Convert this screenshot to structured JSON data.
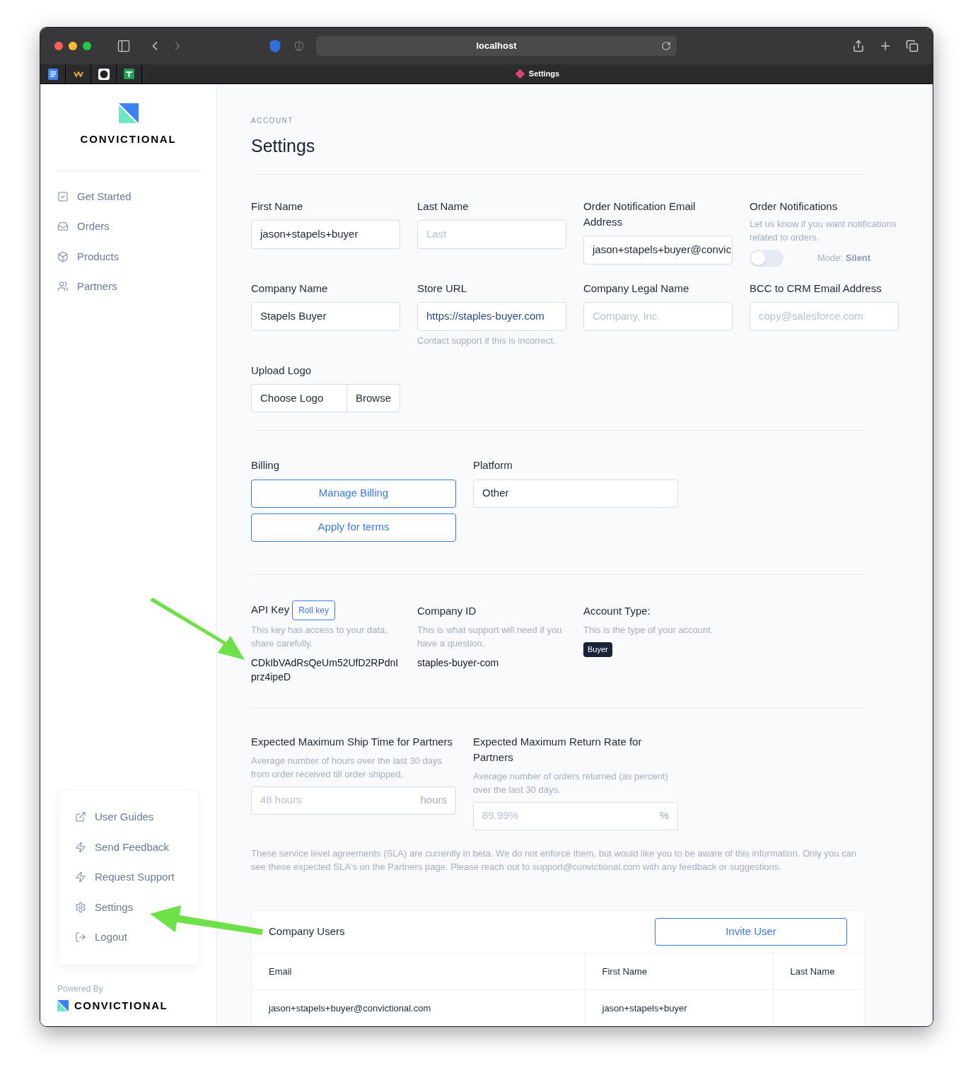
{
  "browser": {
    "url": "localhost",
    "tab_title": "Settings"
  },
  "sidebar": {
    "brand": "CONVICTIONAL",
    "nav": [
      {
        "label": "Get Started",
        "kind": "checklist"
      },
      {
        "label": "Orders",
        "kind": "inbox"
      },
      {
        "label": "Products",
        "kind": "box"
      },
      {
        "label": "Partners",
        "kind": "users"
      }
    ],
    "footer_links": [
      {
        "label": "User Guides",
        "kind": "external"
      },
      {
        "label": "Send Feedback",
        "kind": "bolt"
      },
      {
        "label": "Request Support",
        "kind": "bolt"
      },
      {
        "label": "Settings",
        "kind": "gear"
      },
      {
        "label": "Logout",
        "kind": "logout"
      }
    ],
    "powered_by": "Powered By",
    "powered_brand": "CONVICTIONAL"
  },
  "page": {
    "eyebrow": "ACCOUNT",
    "title": "Settings"
  },
  "profile_fields": [
    {
      "kind": "input",
      "label": "First Name",
      "value": "jason+stapels+buyer"
    },
    {
      "kind": "input",
      "label": "Last Name",
      "placeholder": "Last"
    },
    {
      "kind": "input",
      "label": "Order Notification Email Address",
      "value": "jason+stapels+buyer@convic"
    },
    {
      "kind": "toggle",
      "label": "Order Notifications",
      "description": "Let us know if you want notifications related to orders.",
      "on": false,
      "mode_text": "Mode: **Silent**."
    },
    {
      "kind": "input",
      "label": "Company Name",
      "value": "Stapels Buyer"
    },
    {
      "kind": "url",
      "label": "Store URL",
      "value": "https://staples-buyer.com",
      "hint": "Contact support if this is incorrect."
    },
    {
      "kind": "input",
      "label": "Company Legal Name",
      "placeholder": "Company, Inc."
    },
    {
      "kind": "input",
      "label": "BCC to CRM Email Address",
      "placeholder": "copy@salesforce.com"
    }
  ],
  "upload_logo": {
    "label": "Upload Logo",
    "value": "Choose Logo",
    "button": "Browse"
  },
  "billing": {
    "label": "Billing",
    "buttons": [
      "Manage Billing",
      "Apply for terms"
    ]
  },
  "platform": {
    "label": "Platform",
    "value": "Other"
  },
  "api_key": {
    "label": "API Key",
    "button": "Roll key",
    "description": "This key has access to your data, share carefully.",
    "value": "CDkIbVAdRsQeUm52UfD2RPdnIprz4ipeD"
  },
  "company_id": {
    "label": "Company ID",
    "description": "This is what support will need if you have a question.",
    "value": "staples-buyer-com"
  },
  "account_type": {
    "label": "Account Type:",
    "description": "This is the type of your account.",
    "badge": "Buyer"
  },
  "sla": [
    {
      "label": "Expected Maximum Ship Time for Partners",
      "description": "Average number of hours over the last 30 days from order received till order shipped.",
      "placeholder": "48 hours",
      "suffix": "hours"
    },
    {
      "label": "Expected Maximum Return Rate for Partners",
      "description": "Average number of orders returned (as percent) over the last 30 days.",
      "placeholder": "89.99%",
      "suffix": "%"
    }
  ],
  "sla_note": "These service level agreements (SLA) are currently in beta. We do not enforce them, but would like you to be aware of this information. Only you can see these expected SLA's on the Partners page. Please reach out to support@convictional.com with any feedback or suggestions.",
  "company_users": {
    "title": "Company Users",
    "button": "Invite User",
    "columns": [
      "Email",
      "First Name",
      "Last Name"
    ],
    "rows": [
      {
        "cells": [
          "jason+stapels+buyer@convictional.com",
          "jason+stapels+buyer"
        ]
      }
    ]
  }
}
